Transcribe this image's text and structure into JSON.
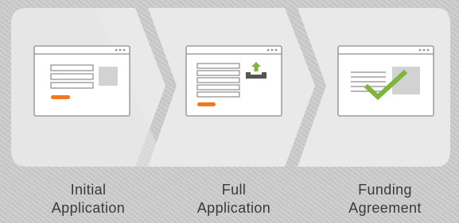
{
  "steps": [
    {
      "line1": "Initial",
      "line2": "Application",
      "icon": "form-window-icon"
    },
    {
      "line1": "Full",
      "line2": "Application",
      "icon": "form-upload-window-icon"
    },
    {
      "line1": "Funding",
      "line2": "Agreement",
      "icon": "signed-agreement-window-icon"
    }
  ],
  "colors": {
    "panel": "#e9e9e9",
    "panel_shade": "#e2e2e2",
    "window_border": "#8d8d8d",
    "window_fill": "#ffffff",
    "accent_orange": "#f0791f",
    "check_green": "#7fb53a",
    "image_placeholder": "#d2d2d2"
  }
}
